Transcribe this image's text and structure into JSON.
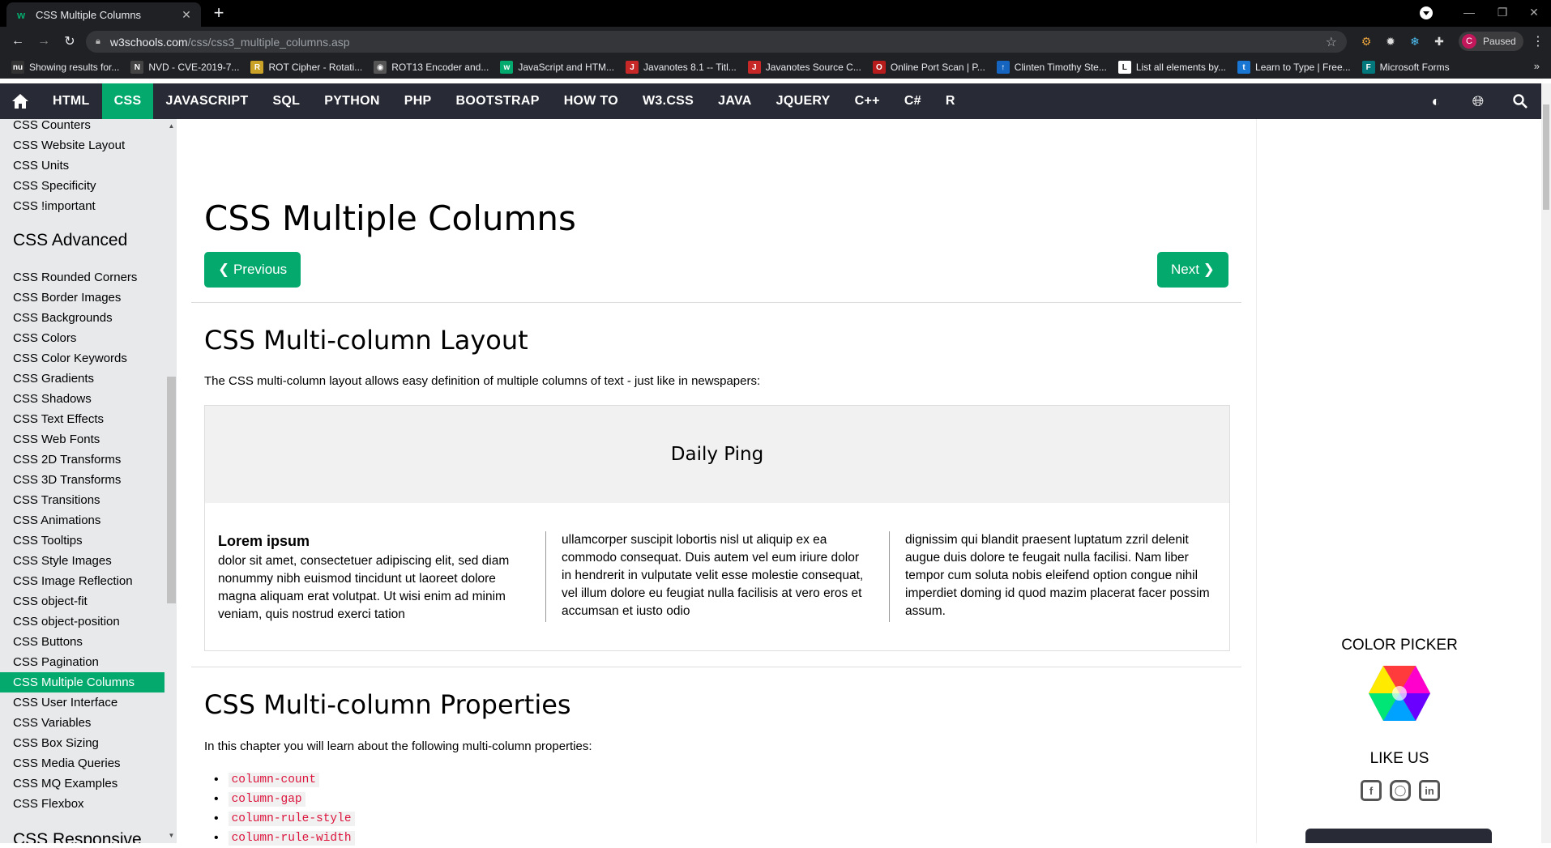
{
  "browser": {
    "tab_title": "CSS Multiple Columns",
    "favicon_letter": "w",
    "new_tab": "+",
    "url_host": "w3schools.com",
    "url_path": "/css/css3_multiple_columns.asp",
    "profile_status": "Paused",
    "profile_initial": "C",
    "bookmarks": [
      {
        "label": "Showing results for...",
        "icon": "nu",
        "color": "#333333"
      },
      {
        "label": "NVD - CVE-2019-7...",
        "icon": "N",
        "color": "#444444"
      },
      {
        "label": "ROT Cipher - Rotati...",
        "icon": "R",
        "color": "#c9a227"
      },
      {
        "label": "ROT13 Encoder and...",
        "icon": "◉",
        "color": "#555555"
      },
      {
        "label": "JavaScript and HTM...",
        "icon": "w",
        "color": "#04aa6d"
      },
      {
        "label": "Javanotes 8.1 -- Titl...",
        "icon": "J",
        "color": "#c62828"
      },
      {
        "label": "Javanotes Source C...",
        "icon": "J",
        "color": "#c62828"
      },
      {
        "label": "Online Port Scan | P...",
        "icon": "O",
        "color": "#b71c1c"
      },
      {
        "label": "Clinten Timothy Ste...",
        "icon": "↑",
        "color": "#1565c0"
      },
      {
        "label": "List all elements by...",
        "icon": "L",
        "color": "#ffffff"
      },
      {
        "label": "Learn to Type | Free...",
        "icon": "t",
        "color": "#1976d2"
      },
      {
        "label": "Microsoft Forms",
        "icon": "F",
        "color": "#03787c"
      }
    ]
  },
  "topnav": {
    "links": [
      "HTML",
      "CSS",
      "JAVASCRIPT",
      "SQL",
      "PYTHON",
      "PHP",
      "BOOTSTRAP",
      "HOW TO",
      "W3.CSS",
      "JAVA",
      "JQUERY",
      "C++",
      "C#",
      "R"
    ],
    "active": "CSS",
    "accent_color": "#04aa6d"
  },
  "sidebar": {
    "items_top": [
      "CSS Counters",
      "CSS Website Layout",
      "CSS Units",
      "CSS Specificity",
      "CSS !important"
    ],
    "heading_advanced": "CSS Advanced",
    "items_advanced": [
      "CSS Rounded Corners",
      "CSS Border Images",
      "CSS Backgrounds",
      "CSS Colors",
      "CSS Color Keywords",
      "CSS Gradients",
      "CSS Shadows",
      "CSS Text Effects",
      "CSS Web Fonts",
      "CSS 2D Transforms",
      "CSS 3D Transforms",
      "CSS Transitions",
      "CSS Animations",
      "CSS Tooltips",
      "CSS Style Images",
      "CSS Image Reflection",
      "CSS object-fit",
      "CSS object-position",
      "CSS Buttons",
      "CSS Pagination",
      "CSS Multiple Columns",
      "CSS User Interface",
      "CSS Variables",
      "CSS Box Sizing",
      "CSS Media Queries",
      "CSS MQ Examples",
      "CSS Flexbox"
    ],
    "active_item": "CSS Multiple Columns",
    "heading_responsive": "CSS Responsive"
  },
  "main": {
    "title": "CSS Multiple Columns",
    "prev_label": "❮ Previous",
    "next_label": "Next ❯",
    "section1_heading": "CSS Multi-column Layout",
    "section1_text": "The CSS multi-column layout allows easy definition of multiple columns of text - just like in newspapers:",
    "demo": {
      "headline": "Daily Ping",
      "col1_title": "Lorem ipsum",
      "col1_text": "dolor sit amet, consectetuer adipiscing elit, sed diam nonummy nibh euismod tincidunt ut laoreet dolore magna aliquam erat volutpat. Ut wisi enim ad minim veniam, quis nostrud exerci tation",
      "col2_text": "ullamcorper suscipit lobortis nisl ut aliquip ex ea commodo consequat. Duis autem vel eum iriure dolor in hendrerit in vulputate velit esse molestie consequat, vel illum dolore eu feugiat nulla facilisis at vero eros et accumsan et iusto odio",
      "col3_text": "dignissim qui blandit praesent luptatum zzril delenit augue duis dolore te feugait nulla facilisi. Nam liber tempor cum soluta nobis eleifend option congue nihil imperdiet doming id quod mazim placerat facer possim assum."
    },
    "section2_heading": "CSS Multi-column Properties",
    "section2_text": "In this chapter you will learn about the following multi-column properties:",
    "properties": [
      "column-count",
      "column-gap",
      "column-rule-style",
      "column-rule-width"
    ]
  },
  "right": {
    "color_picker_label": "COLOR PICKER",
    "like_us_label": "LIKE US"
  }
}
